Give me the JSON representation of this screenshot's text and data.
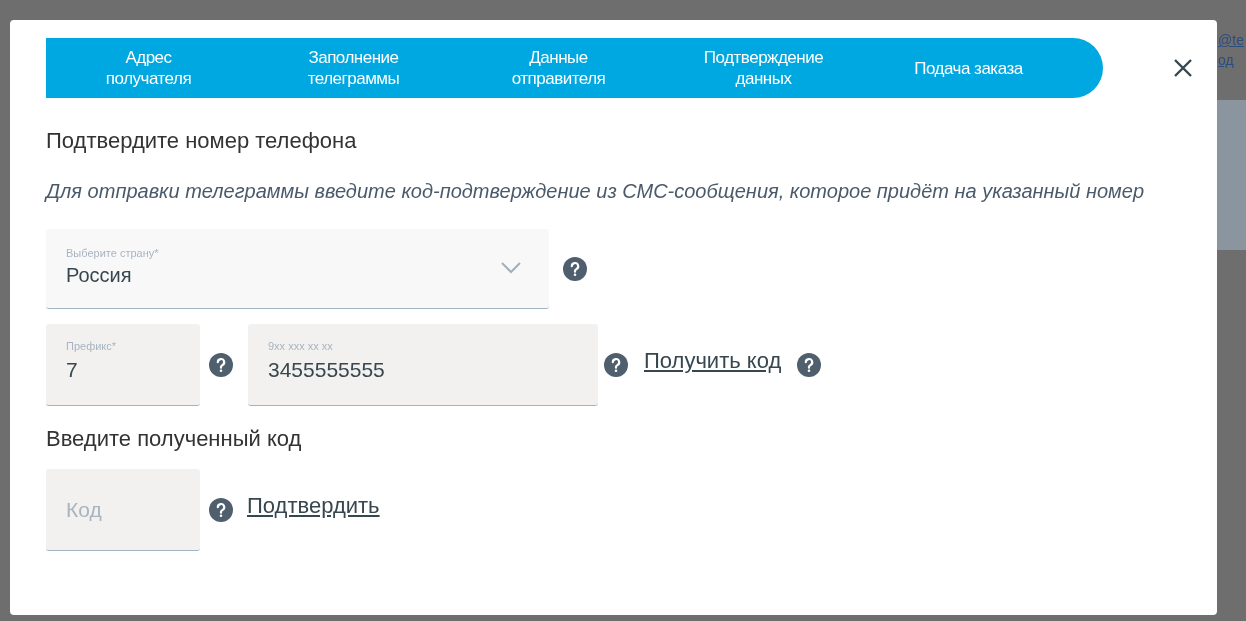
{
  "background": {
    "texts": [
      "@te",
      "од"
    ]
  },
  "steps": [
    {
      "label": "Адрес получателя"
    },
    {
      "label": "Заполнение телеграммы"
    },
    {
      "label": "Данные отправителя"
    },
    {
      "label": "Подтверждение данных"
    },
    {
      "label": "Подача заказа"
    }
  ],
  "heading": "Подтвердите номер телефона",
  "note": "Для отправки телеграммы введите код-подтверждение из СМС-сообщения, которое придёт на указанный номер",
  "country": {
    "label": "Выберите страну*",
    "value": "Россия"
  },
  "prefix": {
    "label": "Префикс*",
    "value": "7"
  },
  "phone": {
    "label": "9xx xxx xx xx",
    "value": "3455555555"
  },
  "get_code_link": "Получить код",
  "code_heading": "Введите полученный код",
  "code": {
    "placeholder": "Код"
  },
  "confirm_link": "Подтвердить"
}
